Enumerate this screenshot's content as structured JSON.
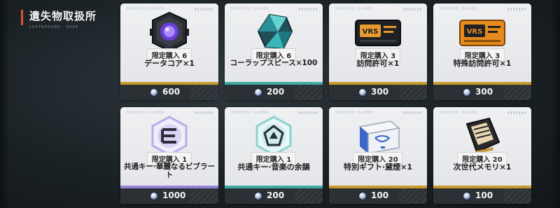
{
  "header": {
    "title": "遺失物取扱所",
    "subtitle": "LOST&FOUND · SHOP"
  },
  "colors": {
    "accent": "#e0532b",
    "gold": "#c89a2d",
    "teal": "#3fa9a4",
    "purple": "#9783d6",
    "price_bar": "#2b3034"
  },
  "items": [
    {
      "name": "データコア×1",
      "limit": "限定購入 6",
      "price": "600",
      "icon": "data-core-icon",
      "rarity": "gold"
    },
    {
      "name": "コーラップスピース×100",
      "limit": "限定購入 6",
      "price": "200",
      "icon": "crystal-shard-icon",
      "rarity": "teal"
    },
    {
      "name": "訪問許可×1",
      "limit": "限定購入 3",
      "price": "300",
      "icon": "visit-pass-icon",
      "rarity": "gold"
    },
    {
      "name": "特殊訪問許可×1",
      "limit": "限定購入 3",
      "price": "300",
      "icon": "special-pass-icon",
      "rarity": "gold"
    },
    {
      "name": "共通キー·華麗なるビブラート",
      "limit": "限定購入 1",
      "price": "1000",
      "icon": "key-emblem-icon",
      "rarity": "purple"
    },
    {
      "name": "共通キー·音楽の余韻",
      "limit": "限定購入 1",
      "price": "200",
      "icon": "key-crest-icon",
      "rarity": "teal"
    },
    {
      "name": "特別ギフト·黛煙×1",
      "limit": "限定購入 20",
      "price": "100",
      "icon": "gift-box-icon",
      "rarity": "gold"
    },
    {
      "name": "次世代メモリ×1",
      "limit": "限定購入 20",
      "price": "100",
      "icon": "memory-chip-icon",
      "rarity": "gold"
    }
  ],
  "card_code": "RHODES ISLAND"
}
